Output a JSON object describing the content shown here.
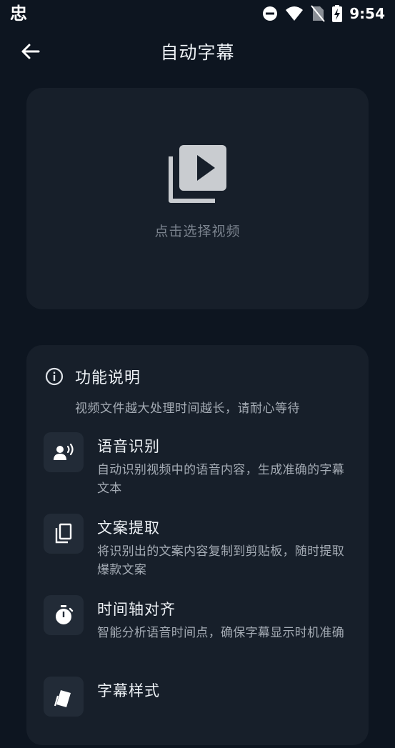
{
  "status_bar": {
    "app_glyph": "忠",
    "time": "9:54",
    "icons": [
      "dnd-icon",
      "wifi-icon",
      "no-sim-icon",
      "battery-charging-icon"
    ]
  },
  "header": {
    "title": "自动字幕",
    "back_icon": "arrow-left-icon"
  },
  "video_picker": {
    "icon": "video-library-icon",
    "hint": "点击选择视频"
  },
  "info": {
    "icon": "info-icon",
    "title": "功能说明",
    "subtitle": "视频文件越大处理时间越长，请耐心等待",
    "features": [
      {
        "icon": "voice-recognition-icon",
        "title": "语音识别",
        "desc": "自动识别视频中的语音内容，生成准确的字幕文本"
      },
      {
        "icon": "copy-icon",
        "title": "文案提取",
        "desc": "将识别出的文案内容复制到剪贴板，随时提取爆款文案"
      },
      {
        "icon": "timer-icon",
        "title": "时间轴对齐",
        "desc": "智能分析语音时间点，确保字幕显示时机准确"
      },
      {
        "icon": "style-icon",
        "title": "字幕样式",
        "desc": ""
      }
    ]
  },
  "colors": {
    "background": "#0d1520",
    "card": "#171f2a",
    "icon_tile": "#222b37",
    "secondary_text": "#a4abb4",
    "hint_text": "#7a828d"
  }
}
